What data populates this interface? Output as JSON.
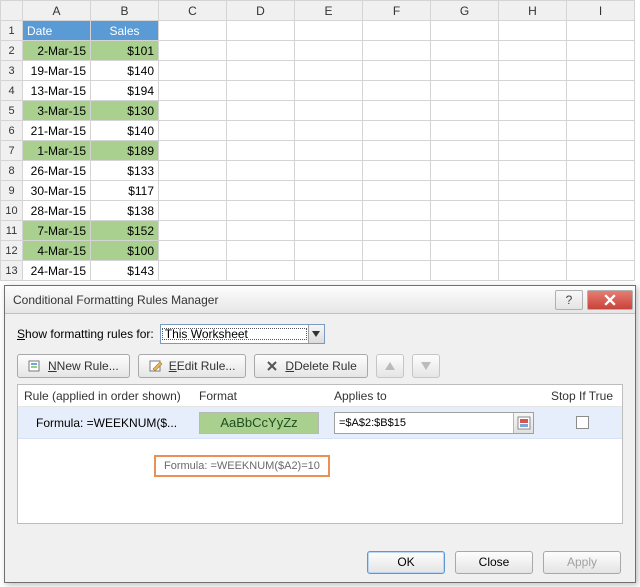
{
  "sheet": {
    "columns": [
      "A",
      "B",
      "C",
      "D",
      "E",
      "F",
      "G",
      "H",
      "I"
    ],
    "header_row": {
      "date": "Date",
      "sales": "Sales"
    },
    "rows": [
      {
        "n": 1,
        "date": "",
        "sales": "",
        "hl": false,
        "is_header": true
      },
      {
        "n": 2,
        "date": "2-Mar-15",
        "sales": "$101",
        "hl": true
      },
      {
        "n": 3,
        "date": "19-Mar-15",
        "sales": "$140",
        "hl": false
      },
      {
        "n": 4,
        "date": "13-Mar-15",
        "sales": "$194",
        "hl": false
      },
      {
        "n": 5,
        "date": "3-Mar-15",
        "sales": "$130",
        "hl": true
      },
      {
        "n": 6,
        "date": "21-Mar-15",
        "sales": "$140",
        "hl": false
      },
      {
        "n": 7,
        "date": "1-Mar-15",
        "sales": "$189",
        "hl": true
      },
      {
        "n": 8,
        "date": "26-Mar-15",
        "sales": "$133",
        "hl": false
      },
      {
        "n": 9,
        "date": "30-Mar-15",
        "sales": "$117",
        "hl": false
      },
      {
        "n": 10,
        "date": "28-Mar-15",
        "sales": "$138",
        "hl": false
      },
      {
        "n": 11,
        "date": "7-Mar-15",
        "sales": "$152",
        "hl": true
      },
      {
        "n": 12,
        "date": "4-Mar-15",
        "sales": "$100",
        "hl": true
      },
      {
        "n": 13,
        "date": "24-Mar-15",
        "sales": "$143",
        "hl": false
      }
    ]
  },
  "dialog": {
    "title": "Conditional Formatting Rules Manager",
    "help": "?",
    "show_label_pre": "S",
    "show_label_mid": "how formatting rules for:",
    "scope_value": "This Worksheet",
    "buttons": {
      "new": "New Rule...",
      "edit": "Edit Rule...",
      "delete": "Delete Rule"
    },
    "headers": {
      "rule": "Rule (applied in order shown)",
      "format": "Format",
      "applies": "Applies to",
      "stop": "Stop If True"
    },
    "rule": {
      "label": "Formula: =WEEKNUM($...",
      "preview": "AaBbCcYyZz",
      "applies": "=$A$2:$B$15"
    },
    "tooltip": "Formula: =WEEKNUM($A2)=10",
    "footer": {
      "ok": "OK",
      "close": "Close",
      "apply": "Apply"
    }
  }
}
